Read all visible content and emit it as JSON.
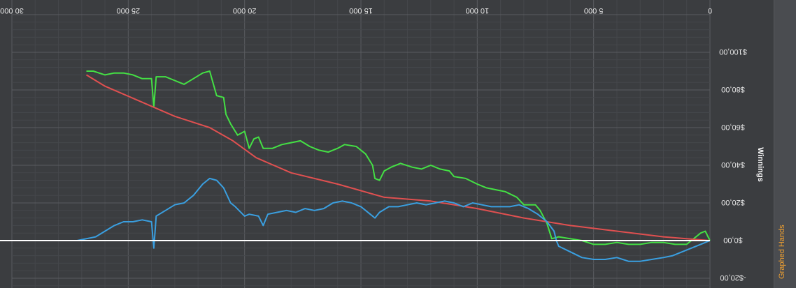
{
  "side_tab": {
    "label": "Graphed Hands"
  },
  "chart_data": {
    "type": "line",
    "title": "",
    "ylabel": "Winnings",
    "xlabel": "",
    "x_ticks": [
      0,
      5000,
      10000,
      15000,
      20000,
      25000,
      30000
    ],
    "x_tick_labels": [
      "0",
      "5 000",
      "10 000",
      "15 000",
      "20 000",
      "25 000",
      "30 000"
    ],
    "y_ticks": [
      -20,
      0,
      20,
      40,
      60,
      80,
      100
    ],
    "y_tick_labels": [
      "-$20,00",
      "$0,00",
      "$20,00",
      "$40,00",
      "$60,00",
      "$80,00",
      "$100,00"
    ],
    "xlim": [
      0,
      30000
    ],
    "ylim": [
      -24,
      120
    ],
    "grid": true,
    "orientation_note": "rendered rotated 180 degrees",
    "series": [
      {
        "color": "#44e044",
        "points": [
          [
            0,
            0
          ],
          [
            200,
            5
          ],
          [
            400,
            4
          ],
          [
            700,
            1
          ],
          [
            1000,
            -2
          ],
          [
            1500,
            -2
          ],
          [
            2000,
            -1
          ],
          [
            2500,
            -1
          ],
          [
            3000,
            -2
          ],
          [
            3500,
            -2
          ],
          [
            4000,
            -1
          ],
          [
            4500,
            -2
          ],
          [
            5000,
            -2
          ],
          [
            5500,
            0
          ],
          [
            6000,
            1
          ],
          [
            6500,
            2
          ],
          [
            6800,
            1
          ],
          [
            7000,
            9
          ],
          [
            7300,
            16
          ],
          [
            7500,
            19
          ],
          [
            8000,
            19
          ],
          [
            8300,
            23
          ],
          [
            8800,
            26
          ],
          [
            9200,
            27
          ],
          [
            9600,
            28
          ],
          [
            10000,
            30
          ],
          [
            10500,
            33
          ],
          [
            11000,
            34
          ],
          [
            11200,
            37
          ],
          [
            11600,
            38
          ],
          [
            12000,
            40
          ],
          [
            12400,
            38
          ],
          [
            12800,
            39
          ],
          [
            13300,
            41
          ],
          [
            13700,
            39
          ],
          [
            14000,
            37
          ],
          [
            14200,
            32
          ],
          [
            14400,
            33
          ],
          [
            14500,
            40
          ],
          [
            14800,
            46
          ],
          [
            15200,
            50
          ],
          [
            15700,
            51
          ],
          [
            16000,
            49
          ],
          [
            16400,
            47
          ],
          [
            16800,
            48
          ],
          [
            17200,
            50
          ],
          [
            17600,
            53
          ],
          [
            18000,
            52
          ],
          [
            18400,
            51
          ],
          [
            18800,
            49
          ],
          [
            19200,
            49
          ],
          [
            19400,
            55
          ],
          [
            19600,
            54
          ],
          [
            19800,
            49
          ],
          [
            20000,
            58
          ],
          [
            20300,
            56
          ],
          [
            20600,
            62
          ],
          [
            20800,
            67
          ],
          [
            20900,
            76
          ],
          [
            21200,
            77
          ],
          [
            21500,
            90
          ],
          [
            21800,
            89
          ],
          [
            22200,
            86
          ],
          [
            22600,
            83
          ],
          [
            23000,
            85
          ],
          [
            23400,
            87
          ],
          [
            23800,
            87
          ],
          [
            23900,
            71
          ],
          [
            24000,
            86
          ],
          [
            24400,
            86
          ],
          [
            24800,
            88
          ],
          [
            25200,
            89
          ],
          [
            25600,
            89
          ],
          [
            26000,
            88
          ],
          [
            26500,
            90
          ],
          [
            26800,
            90
          ]
        ]
      },
      {
        "color": "#e05050",
        "points": [
          [
            0,
            0
          ],
          [
            2000,
            2
          ],
          [
            4000,
            5
          ],
          [
            6000,
            8
          ],
          [
            8000,
            12
          ],
          [
            10000,
            17
          ],
          [
            12000,
            21
          ],
          [
            14000,
            23
          ],
          [
            16000,
            30
          ],
          [
            18000,
            36
          ],
          [
            19500,
            44
          ],
          [
            20500,
            53
          ],
          [
            21500,
            60
          ],
          [
            23000,
            66
          ],
          [
            24500,
            74
          ],
          [
            26000,
            82
          ],
          [
            26800,
            88
          ]
        ]
      },
      {
        "color": "#3a9fe0",
        "points": [
          [
            0,
            0
          ],
          [
            400,
            -2
          ],
          [
            800,
            -4
          ],
          [
            1200,
            -6
          ],
          [
            1600,
            -8
          ],
          [
            2000,
            -9
          ],
          [
            2500,
            -10
          ],
          [
            3000,
            -11
          ],
          [
            3500,
            -11
          ],
          [
            4000,
            -9
          ],
          [
            4500,
            -10
          ],
          [
            5000,
            -10
          ],
          [
            5500,
            -9
          ],
          [
            6000,
            -6
          ],
          [
            6500,
            -3
          ],
          [
            6600,
            0
          ],
          [
            6700,
            5
          ],
          [
            7000,
            10
          ],
          [
            7400,
            14
          ],
          [
            7800,
            17
          ],
          [
            8200,
            19
          ],
          [
            8600,
            18
          ],
          [
            9000,
            18
          ],
          [
            9400,
            18
          ],
          [
            9800,
            19
          ],
          [
            10200,
            20
          ],
          [
            10600,
            18
          ],
          [
            11000,
            20
          ],
          [
            11400,
            21
          ],
          [
            11800,
            20
          ],
          [
            12200,
            19
          ],
          [
            12600,
            20
          ],
          [
            13000,
            19
          ],
          [
            13400,
            18
          ],
          [
            13800,
            18
          ],
          [
            14200,
            15
          ],
          [
            14400,
            12
          ],
          [
            14600,
            14
          ],
          [
            15000,
            18
          ],
          [
            15400,
            20
          ],
          [
            15800,
            21
          ],
          [
            16200,
            20
          ],
          [
            16600,
            17
          ],
          [
            17000,
            16
          ],
          [
            17400,
            17
          ],
          [
            17800,
            15
          ],
          [
            18200,
            16
          ],
          [
            18600,
            15
          ],
          [
            19000,
            14
          ],
          [
            19200,
            8
          ],
          [
            19400,
            13
          ],
          [
            19800,
            14
          ],
          [
            20000,
            13
          ],
          [
            20400,
            18
          ],
          [
            20600,
            20
          ],
          [
            20900,
            28
          ],
          [
            21200,
            32
          ],
          [
            21500,
            33
          ],
          [
            21800,
            30
          ],
          [
            22200,
            24
          ],
          [
            22600,
            20
          ],
          [
            23000,
            19
          ],
          [
            23400,
            16
          ],
          [
            23800,
            13
          ],
          [
            23900,
            -4
          ],
          [
            24000,
            10
          ],
          [
            24400,
            11
          ],
          [
            24800,
            10
          ],
          [
            25200,
            10
          ],
          [
            25600,
            8
          ],
          [
            26000,
            5
          ],
          [
            26400,
            2
          ],
          [
            26800,
            1
          ],
          [
            27200,
            0
          ]
        ]
      }
    ],
    "zero_line": {
      "color": "#ffffff",
      "value": 0
    }
  }
}
